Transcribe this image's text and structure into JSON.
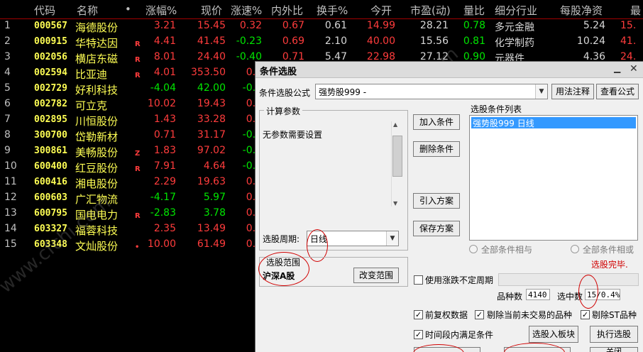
{
  "table": {
    "columns": {
      "code": "代码",
      "name": "名称",
      "dot": "•",
      "change_pct": "涨幅%",
      "price": "现价",
      "speed": "涨速%",
      "inner_outer": "内外比",
      "turnover": "换手%",
      "open": "今开",
      "pe": "市盈(动)",
      "vol_ratio": "量比",
      "industry": "细分行业",
      "nav": "每股净资",
      "last": "最"
    },
    "rows": [
      {
        "idx": "1",
        "code": "000567",
        "name": "海德股份",
        "flag": "",
        "chg": "3.21",
        "price": "15.45",
        "speed": "0.32",
        "io": "0.67",
        "turn": "0.61",
        "open": "14.99",
        "pe": "28.21",
        "vr": "0.78",
        "ind": "多元金融",
        "nav": "5.24",
        "last": "15."
      },
      {
        "idx": "2",
        "code": "000915",
        "name": "华特达因",
        "flag": "R",
        "chg": "4.41",
        "price": "41.45",
        "speed": "-0.23",
        "io": "0.69",
        "turn": "2.10",
        "open": "40.00",
        "pe": "15.56",
        "vr": "0.81",
        "ind": "化学制药",
        "nav": "10.24",
        "last": "41."
      },
      {
        "idx": "3",
        "code": "002056",
        "name": "横店东磁",
        "flag": "R",
        "chg": "8.01",
        "price": "24.40",
        "speed": "-0.40",
        "io": "0.71",
        "turn": "5.47",
        "open": "22.98",
        "pe": "27.12",
        "vr": "0.90",
        "ind": "元器件",
        "nav": "4.36",
        "last": "24."
      },
      {
        "idx": "4",
        "code": "002594",
        "name": "比亚迪",
        "flag": "R",
        "chg": "4.01",
        "price": "353.50",
        "speed": "0.1",
        "io": "",
        "turn": "",
        "open": "",
        "pe": "",
        "vr": "",
        "ind": "",
        "nav": "",
        "last": ""
      },
      {
        "idx": "5",
        "code": "002729",
        "name": "好利科技",
        "flag": "",
        "chg": "-4.04",
        "price": "42.00",
        "speed": "-0.0",
        "io": "",
        "turn": "",
        "open": "",
        "pe": "",
        "vr": "",
        "ind": "",
        "nav": "",
        "last": ""
      },
      {
        "idx": "6",
        "code": "002782",
        "name": "可立克",
        "flag": "",
        "chg": "10.02",
        "price": "19.43",
        "speed": "0.0",
        "io": "",
        "turn": "",
        "open": "",
        "pe": "",
        "vr": "",
        "ind": "",
        "nav": "",
        "last": ""
      },
      {
        "idx": "7",
        "code": "002895",
        "name": "川恒股份",
        "flag": "",
        "chg": "1.43",
        "price": "33.28",
        "speed": "0.2",
        "io": "",
        "turn": "",
        "open": "",
        "pe": "",
        "vr": "",
        "ind": "",
        "nav": "",
        "last": ""
      },
      {
        "idx": "8",
        "code": "300700",
        "name": "岱勒新材",
        "flag": "",
        "chg": "0.71",
        "price": "31.17",
        "speed": "-0.0",
        "io": "",
        "turn": "",
        "open": "",
        "pe": "",
        "vr": "",
        "ind": "",
        "nav": "",
        "last": ""
      },
      {
        "idx": "9",
        "code": "300861",
        "name": "美畅股份",
        "flag": "Z",
        "chg": "1.83",
        "price": "97.02",
        "speed": "-0.2",
        "io": "",
        "turn": "",
        "open": "",
        "pe": "",
        "vr": "",
        "ind": "",
        "nav": "",
        "last": ""
      },
      {
        "idx": "10",
        "code": "600400",
        "name": "红豆股份",
        "flag": "R",
        "chg": "7.91",
        "price": "4.64",
        "speed": "-0.2",
        "io": "",
        "turn": "",
        "open": "",
        "pe": "",
        "vr": "",
        "ind": "",
        "nav": "",
        "last": ""
      },
      {
        "idx": "11",
        "code": "600416",
        "name": "湘电股份",
        "flag": "",
        "chg": "2.29",
        "price": "19.63",
        "speed": "0.1",
        "io": "",
        "turn": "",
        "open": "",
        "pe": "",
        "vr": "",
        "ind": "",
        "nav": "",
        "last": ""
      },
      {
        "idx": "12",
        "code": "600603",
        "name": "广汇物流",
        "flag": "",
        "chg": "-4.17",
        "price": "5.97",
        "speed": "0.6",
        "io": "",
        "turn": "",
        "open": "",
        "pe": "",
        "vr": "",
        "ind": "",
        "nav": "",
        "last": ""
      },
      {
        "idx": "13",
        "code": "600795",
        "name": "国电电力",
        "flag": "R",
        "chg": "-2.83",
        "price": "3.78",
        "speed": "0.0",
        "io": "",
        "turn": "",
        "open": "",
        "pe": "",
        "vr": "",
        "ind": "",
        "nav": "",
        "last": ""
      },
      {
        "idx": "14",
        "code": "603327",
        "name": "福蓉科技",
        "flag": "",
        "chg": "2.35",
        "price": "13.49",
        "speed": "0.3",
        "io": "",
        "turn": "",
        "open": "",
        "pe": "",
        "vr": "",
        "ind": "",
        "nav": "",
        "last": ""
      },
      {
        "idx": "15",
        "code": "603348",
        "name": "文灿股份",
        "flag": "•",
        "chg": "10.00",
        "price": "61.49",
        "speed": "0.0",
        "io": "",
        "turn": "",
        "open": "",
        "pe": "",
        "vr": "",
        "ind": "",
        "nav": "",
        "last": ""
      }
    ]
  },
  "dialog": {
    "title": "条件选股",
    "formula_label": "条件选股公式",
    "formula_value": "强势股999      -",
    "usage_button": "用法注释",
    "view_formula_button": "查看公式",
    "calc_params_label": "计算参数",
    "no_params_text": "无参数需要设置",
    "add_condition": "加入条件",
    "delete_condition": "删除条件",
    "import_plan": "引入方案",
    "save_plan": "保存方案",
    "condition_list_label": "选股条件列表",
    "condition_item": "强势股999   日线",
    "period_label": "选股周期:",
    "period_value": "日线",
    "all_and": "全部条件相与",
    "all_or": "全部条件相或",
    "status": "选股完毕.",
    "scope_label": "选股范围",
    "scope_value": "沪深A股",
    "change_scope": "改变范围",
    "variable_period": "使用涨跌不定周期",
    "variety_count_label": "品种数",
    "variety_count": "4140",
    "selected_label": "选中数",
    "selected_value": "15/0.4%",
    "pre_adjust": "前复权数据",
    "exclude_untraded": "剔除当前未交易的品种",
    "exclude_st": "剔除ST品种",
    "period_satisfy": "时间段内满足条件",
    "select_to_block": "选股入板块",
    "execute": "执行选股",
    "partial_button": "关闭"
  },
  "colors": {
    "bg": "#000000",
    "up": "#ff3c3c",
    "down": "#00e600",
    "code": "#ffff54",
    "dialog_bg": "#f0f0f0",
    "selection": "#3399ff",
    "annotation": "#d00000"
  },
  "watermark": "www.cfchi.com"
}
